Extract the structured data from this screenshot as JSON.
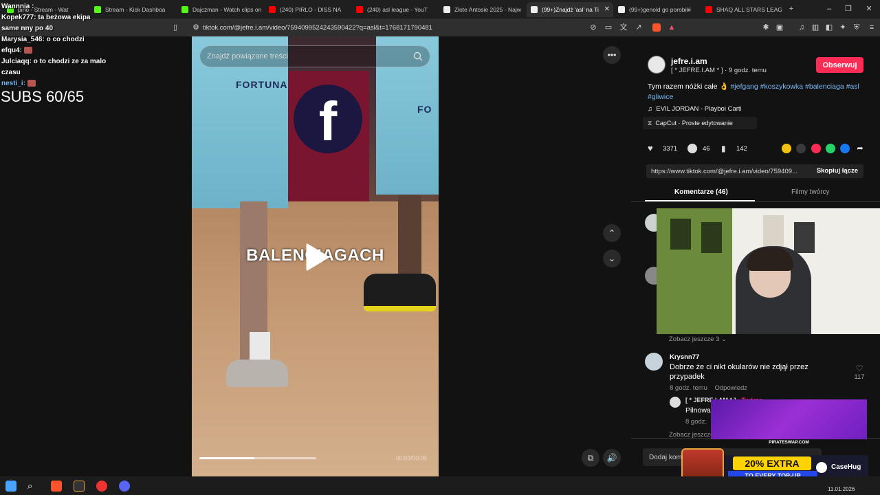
{
  "browser": {
    "tabs": [
      {
        "title": "pirlo - Stream - Wat",
        "color": "#53fc18"
      },
      {
        "title": "Stream - Kick Dashboa",
        "color": "#53fc18"
      },
      {
        "title": "Dajczman - Watch clips on",
        "color": "#53fc18"
      },
      {
        "title": "(240) PIRLO - DISS NA",
        "color": "#ff0000"
      },
      {
        "title": "(240) asl league - YouT",
        "color": "#ff0000"
      },
      {
        "title": "Złote Antosie 2025 - Najw",
        "color": "#ffffff"
      },
      {
        "title": "(99+)Znajdź 'asl' na Ti",
        "color": "#ffffff",
        "active": true
      },
      {
        "title": "(99+)genold go porobił#",
        "color": "#ffffff"
      },
      {
        "title": "SHAQ ALL STARS LEAG",
        "color": "#ff0000"
      }
    ],
    "url": "tiktok.com/@jefre.i.am/video/7594099524243590422?q=asl&t=1768171790481"
  },
  "chat": {
    "lines": [
      {
        "user": "Wannnia :",
        "text": ""
      },
      {
        "user": "Kopek777:",
        "text": "ta beżowa ekipa"
      },
      {
        "user": "",
        "text": "same nny po 40"
      },
      {
        "user": "Marysia_546:",
        "text": "o co chodzi"
      },
      {
        "user": "efqu4:",
        "text": ""
      },
      {
        "user": "Julciaqq:",
        "text": "o to chodzi ze za malo"
      },
      {
        "user": "",
        "text": "czasu"
      },
      {
        "user": "nesti_i:",
        "text": ""
      }
    ],
    "subs": "SUBS 60/65"
  },
  "video": {
    "search_placeholder": "Znajdź powiązane treści",
    "overlay_text": "BALENCIAGACH",
    "time": "00:03/00:05",
    "progress": 0.47,
    "jersey_text": "FORTUNA",
    "jersey_text_short": "FO"
  },
  "panel": {
    "username": "jefre.i.am",
    "subtitle": "[ * JEFRE.I.AM * ] · 9 godz. temu",
    "follow_label": "Obserwuj",
    "desc_text": "Tym razem nóżki całe 👌 ",
    "tags": [
      "#jefgang",
      "#koszykowka",
      "#balenciaga",
      "#asl",
      "#gliwice"
    ],
    "music": "EVIL JORDAN - Playboi Carti",
    "capcut": "CapCut · Proste edytowanie",
    "likes": "3371",
    "comments": "46",
    "saves": "142",
    "link": "https://www.tiktok.com/@jefre.i.am/video/759409...",
    "copy_label": "Skopiuj łącze",
    "tab_comments": "Komentarze (46)",
    "tab_videos": "Filmy twórcy",
    "see_more_1": "Zobacz jeszcze 3",
    "comment_user": "Krysnn77",
    "comment_text": "Dobrze że ci nikt okularów nie zdjął przez przypadek",
    "comment_meta_time": "8 godz. temu",
    "comment_meta_reply": "Odpowiedz",
    "comment_likes": "117",
    "reply_user": "[ * JEFRE.I.AM * ]",
    "reply_tag": "Twórca",
    "reply_text": "Pilnowa",
    "reply_meta": "8 godz.",
    "see_more_2": "Zobacz jeszcze",
    "comment_placeholder": "Dodaj komentarz..."
  },
  "ads": {
    "pirate_label": "PIRATESWAP.COM",
    "bonus": "20% EXTRA",
    "topup": "TO EVERY TOP-UP",
    "brand": "CaseHug"
  },
  "taskbar": {
    "date": "11.01.2026"
  },
  "colors": {
    "follow": "#fe2c55",
    "hashtag": "#7ab8f5",
    "pirate": "#9b2fd6"
  }
}
